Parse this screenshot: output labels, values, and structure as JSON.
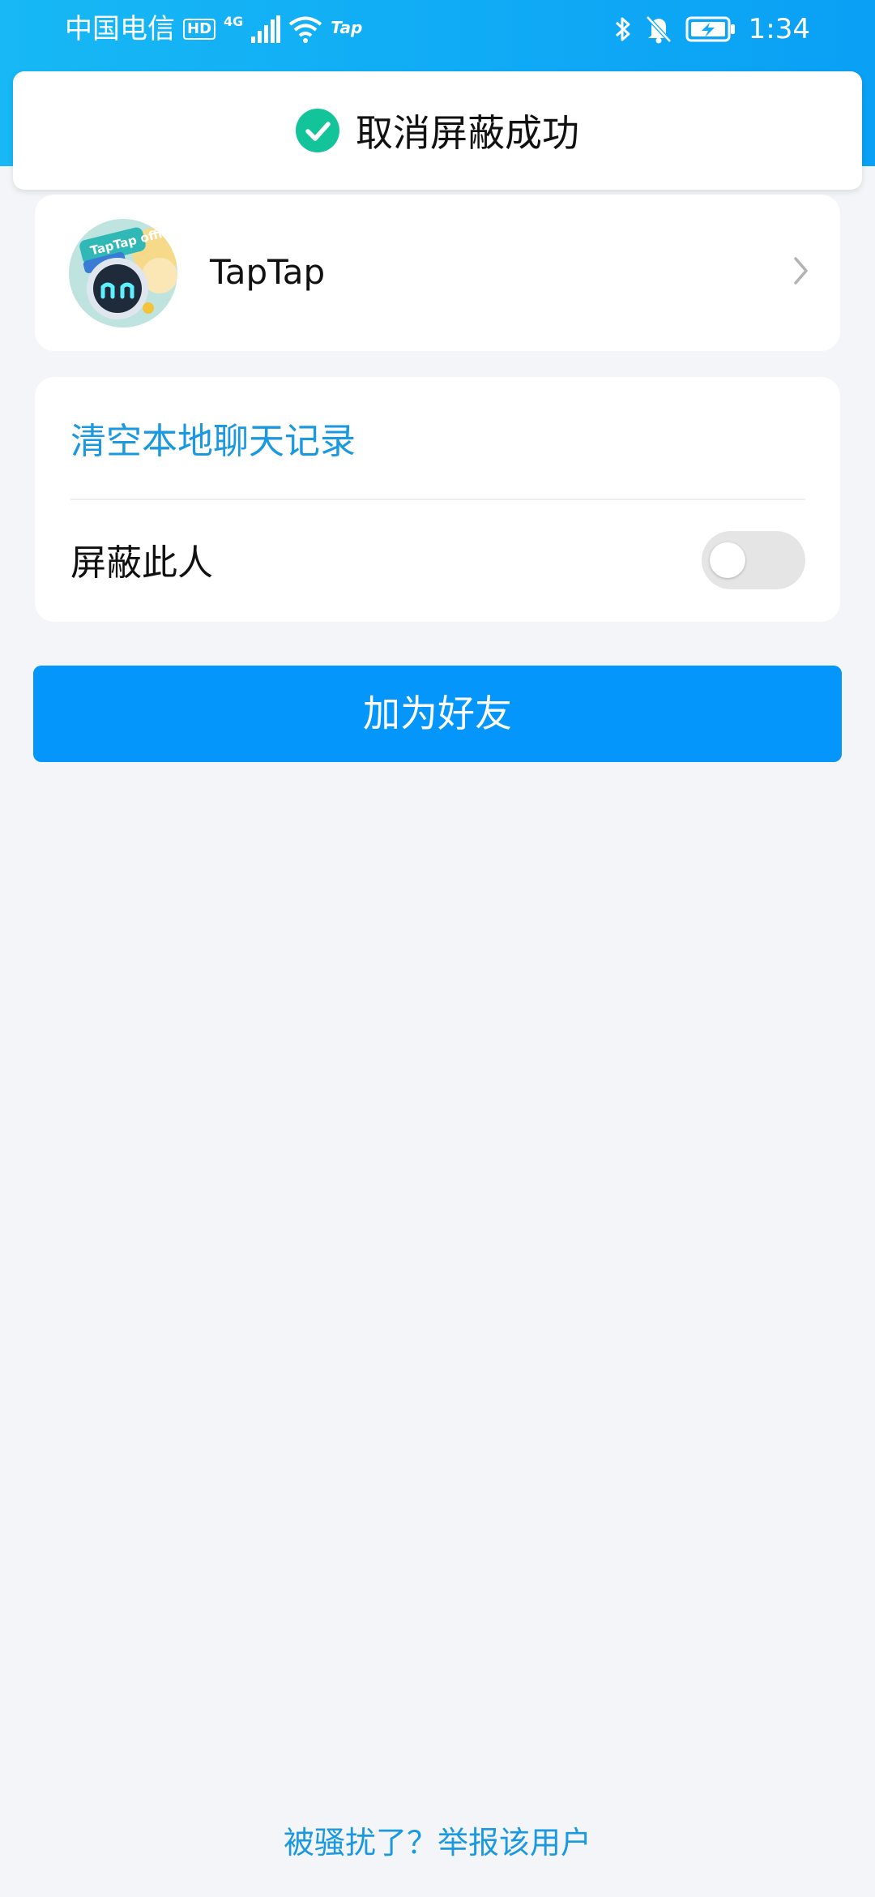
{
  "status_bar": {
    "carrier": "中国电信",
    "hd_badge": "HD",
    "network_type": "4G",
    "app_indicator": "Tap",
    "time": "1:34"
  },
  "toast": {
    "message": "取消屏蔽成功",
    "icon": "check-circle-icon",
    "icon_color": "#13c39a"
  },
  "profile": {
    "name": "TapTap",
    "avatar_badge_text": "TapTap official"
  },
  "options": {
    "clear_chat_label": "清空本地聊天记录",
    "block_label": "屏蔽此人",
    "block_enabled": false
  },
  "actions": {
    "add_friend_label": "加为好友",
    "report_link": "被骚扰了？举报该用户"
  },
  "colors": {
    "header_gradient_start": "#17b8f5",
    "header_gradient_end": "#0aa0f5",
    "primary_button": "#0496fb",
    "link_text": "#1a98e0",
    "page_background": "#f3f5f8"
  }
}
